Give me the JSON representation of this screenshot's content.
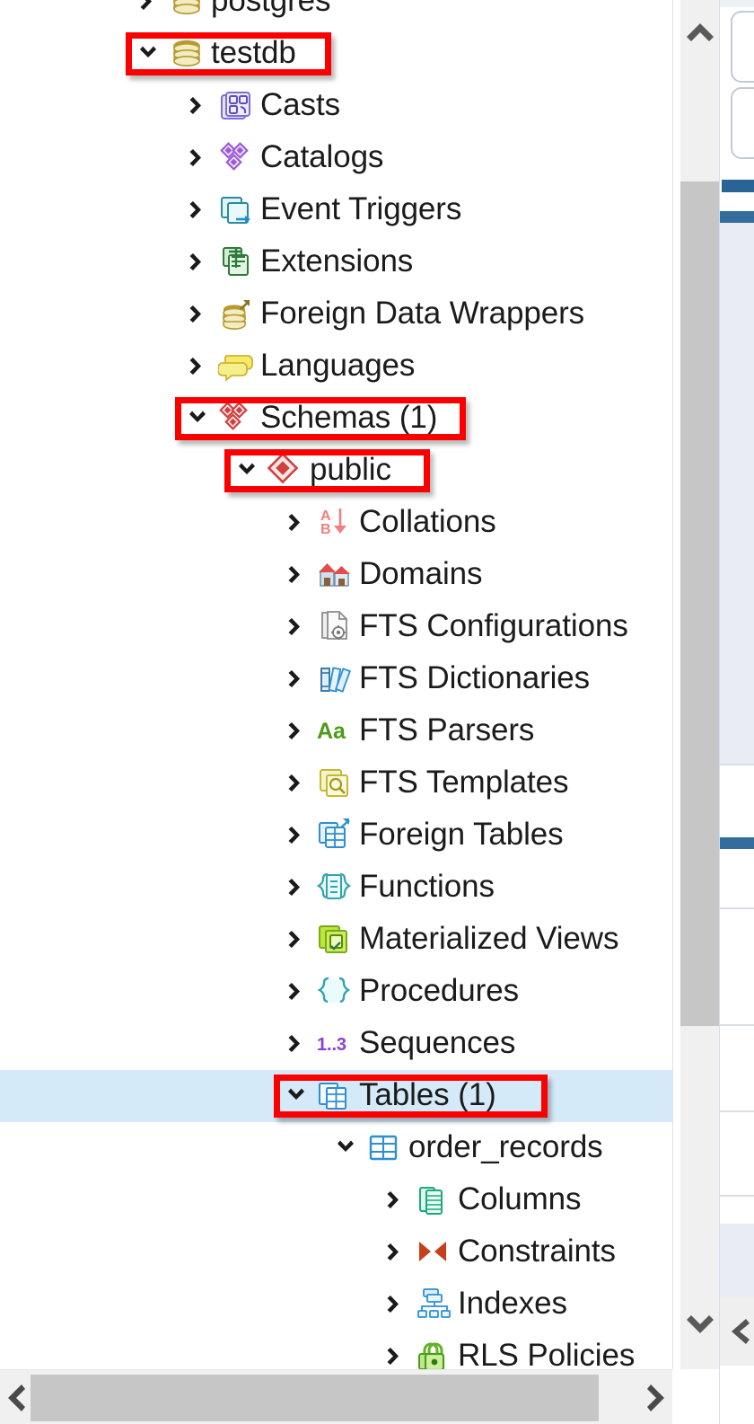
{
  "panel": {
    "name": "browser-tree",
    "selection_color": "#d4eaf9",
    "highlight_color": "#fc0000"
  },
  "tree": {
    "rows": [
      {
        "label": "postgres",
        "icon": "database-icon",
        "indent": 0,
        "state": "collapsed",
        "partial": true,
        "highlighted": false,
        "selected": false
      },
      {
        "label": "testdb",
        "icon": "database-icon",
        "indent": 0,
        "state": "expanded",
        "partial": false,
        "highlighted": true,
        "selected": false
      },
      {
        "label": "Casts",
        "icon": "casts-icon",
        "indent": 1,
        "state": "collapsed",
        "partial": false,
        "highlighted": false,
        "selected": false
      },
      {
        "label": "Catalogs",
        "icon": "catalogs-icon",
        "indent": 1,
        "state": "collapsed",
        "partial": false,
        "highlighted": false,
        "selected": false
      },
      {
        "label": "Event Triggers",
        "icon": "event-triggers-icon",
        "indent": 1,
        "state": "collapsed",
        "partial": false,
        "highlighted": false,
        "selected": false
      },
      {
        "label": "Extensions",
        "icon": "extensions-icon",
        "indent": 1,
        "state": "collapsed",
        "partial": false,
        "highlighted": false,
        "selected": false
      },
      {
        "label": "Foreign Data Wrappers",
        "icon": "foreign-data-wrapper-icon",
        "indent": 1,
        "state": "collapsed",
        "partial": false,
        "highlighted": false,
        "selected": false
      },
      {
        "label": "Languages",
        "icon": "languages-icon",
        "indent": 1,
        "state": "collapsed",
        "partial": false,
        "highlighted": false,
        "selected": false
      },
      {
        "label": "Schemas (1)",
        "icon": "schemas-icon",
        "indent": 1,
        "state": "expanded",
        "partial": false,
        "highlighted": true,
        "selected": false
      },
      {
        "label": "public",
        "icon": "schema-icon",
        "indent": 2,
        "state": "expanded",
        "partial": false,
        "highlighted": true,
        "selected": false
      },
      {
        "label": "Collations",
        "icon": "collations-icon",
        "indent": 3,
        "state": "collapsed",
        "partial": false,
        "highlighted": false,
        "selected": false
      },
      {
        "label": "Domains",
        "icon": "domains-icon",
        "indent": 3,
        "state": "collapsed",
        "partial": false,
        "highlighted": false,
        "selected": false
      },
      {
        "label": "FTS Configurations",
        "icon": "fts-configurations-icon",
        "indent": 3,
        "state": "collapsed",
        "partial": false,
        "highlighted": false,
        "selected": false
      },
      {
        "label": "FTS Dictionaries",
        "icon": "fts-dictionaries-icon",
        "indent": 3,
        "state": "collapsed",
        "partial": false,
        "highlighted": false,
        "selected": false
      },
      {
        "label": "FTS Parsers",
        "icon": "fts-parsers-icon",
        "indent": 3,
        "state": "collapsed",
        "partial": false,
        "highlighted": false,
        "selected": false
      },
      {
        "label": "FTS Templates",
        "icon": "fts-templates-icon",
        "indent": 3,
        "state": "collapsed",
        "partial": false,
        "highlighted": false,
        "selected": false
      },
      {
        "label": "Foreign Tables",
        "icon": "foreign-tables-icon",
        "indent": 3,
        "state": "collapsed",
        "partial": false,
        "highlighted": false,
        "selected": false
      },
      {
        "label": "Functions",
        "icon": "functions-icon",
        "indent": 3,
        "state": "collapsed",
        "partial": false,
        "highlighted": false,
        "selected": false
      },
      {
        "label": "Materialized Views",
        "icon": "materialized-views-icon",
        "indent": 3,
        "state": "collapsed",
        "partial": false,
        "highlighted": false,
        "selected": false
      },
      {
        "label": "Procedures",
        "icon": "procedures-icon",
        "indent": 3,
        "state": "collapsed",
        "partial": false,
        "highlighted": false,
        "selected": false
      },
      {
        "label": "Sequences",
        "icon": "sequences-icon",
        "indent": 3,
        "state": "collapsed",
        "partial": false,
        "highlighted": false,
        "selected": false
      },
      {
        "label": "Tables (1)",
        "icon": "tables-icon",
        "indent": 3,
        "state": "expanded",
        "partial": false,
        "highlighted": true,
        "selected": true
      },
      {
        "label": "order_records",
        "icon": "table-icon",
        "indent": 4,
        "state": "expanded",
        "partial": false,
        "highlighted": false,
        "selected": false
      },
      {
        "label": "Columns",
        "icon": "columns-icon",
        "indent": 5,
        "state": "collapsed",
        "partial": false,
        "highlighted": false,
        "selected": false
      },
      {
        "label": "Constraints",
        "icon": "constraints-icon",
        "indent": 5,
        "state": "collapsed",
        "partial": false,
        "highlighted": false,
        "selected": false
      },
      {
        "label": "Indexes",
        "icon": "indexes-icon",
        "indent": 5,
        "state": "collapsed",
        "partial": false,
        "highlighted": false,
        "selected": false
      },
      {
        "label": "RLS Policies",
        "icon": "rls-policies-icon",
        "indent": 5,
        "state": "collapsed",
        "partial": false,
        "highlighted": false,
        "selected": false
      }
    ]
  },
  "scrollbars": {
    "vertical": {
      "up_icon": "chevron-up-icon",
      "down_icon": "chevron-down-icon"
    },
    "horizontal": {
      "left_icon": "chevron-left-icon",
      "right_icon": "chevron-right-icon"
    }
  },
  "right_panel": {
    "collapse_icon": "chevron-left-icon",
    "accent_color": "#2a6496"
  }
}
